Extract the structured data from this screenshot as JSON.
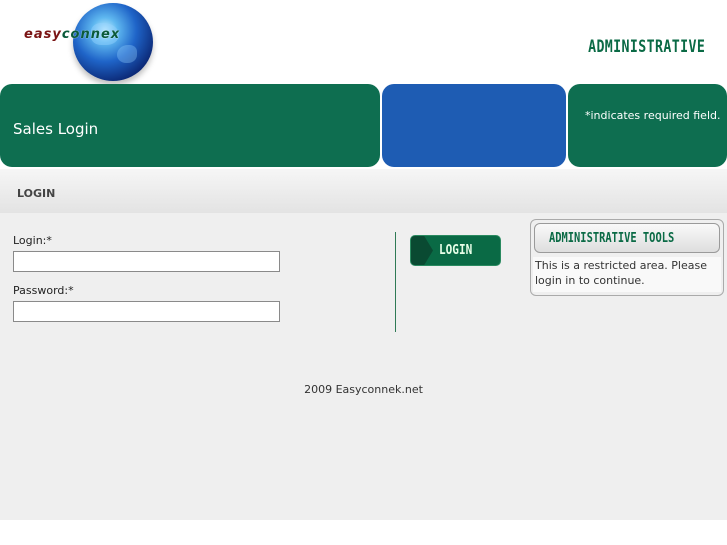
{
  "header": {
    "logo": {
      "text_part1": "easy",
      "text_part2": "connex"
    },
    "admin_title": "ADMINISTRATIVE"
  },
  "bands": {
    "sales_login_title": "Sales Login",
    "required_note": "*indicates required field."
  },
  "section": {
    "label": "LOGIN"
  },
  "form": {
    "login_label": "Login:*",
    "login_value": "",
    "password_label": "Password:*",
    "password_value": "",
    "submit_label": "LOGIN"
  },
  "admin_tools": {
    "title": "ADMINISTRATIVE TOOLS",
    "body": "This is a restricted area. Please login in to continue."
  },
  "footer": {
    "text": "2009 Easyconnek.net"
  },
  "colors": {
    "brand_green": "#0e6e50",
    "brand_blue": "#1e5cb3",
    "content_bg": "#efefef"
  }
}
